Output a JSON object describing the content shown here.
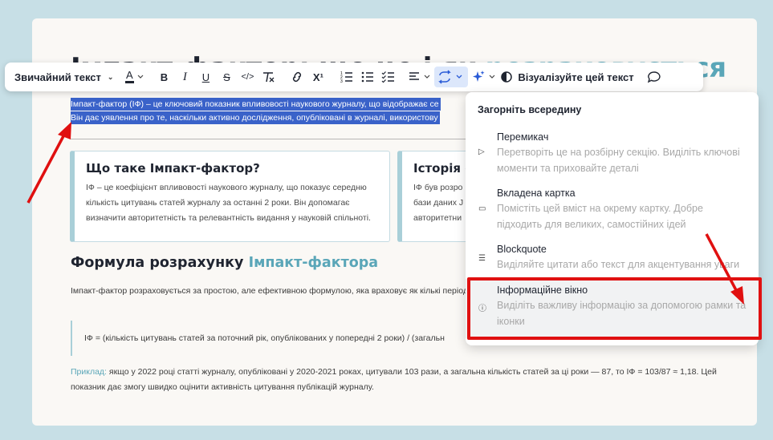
{
  "document": {
    "title_left": "Імпакт-фактор: що це і як",
    "title_right": "розраховується",
    "selected_line1": "Імпакт-фактор (ІФ) – це ключовий показник впливовості наукового журналу, що відображає се",
    "selected_line2": "Він дає уявлення про те, наскільки активно дослідження, опубліковані в журналі, використову",
    "card1_title": "Що таке Імпакт-фактор?",
    "card1_text": "ІФ – це коефіцієнт впливовості наукового журналу, що показує середню кількість цитувань статей журналу за останні 2 роки. Він допомагає визначити авторитетність та релевантність видання у науковій спільноті.",
    "card2_title": "Історія с",
    "card2_line1": "ІФ був розро",
    "card2_line2": "бази даних J",
    "card2_line3": "авторитетни",
    "heading2_a": "Формула розрахунку ",
    "heading2_b": "Імпакт-фактора",
    "paragraph": "Імпакт-фактор розраховується за простою, але ефективною формулою, яка враховує як кількі період.",
    "formula": "ІФ = (кількість цитувань статей за поточний рік, опублікованих у попередні 2 роки) / (загальн",
    "example_label": "Приклад:",
    "example_text": " якщо у 2022 році статті журналу, опубліковані у 2020-2021 роках, цитували 103 рази, а загальна кількість статей за ці роки — 87, то ІФ = 103/87 ≈ 1,18. Цей показник дає змогу швидко оцінити активність цитування публікацій журналу."
  },
  "toolbar": {
    "text_style": "Звичайний текст",
    "bold": "B",
    "italic": "I",
    "underline": "U",
    "strike": "S",
    "code": "</>",
    "superscript": "X¹",
    "visualize_label": "Візуалізуйте цей текст"
  },
  "menu": {
    "heading": "Загорніть всередину",
    "items": [
      {
        "title": "Перемикач",
        "desc": "Перетворіть це на розбірну секцію. Виділіть ключові моменти та приховайте деталі",
        "icon": "triangle-right-icon"
      },
      {
        "title": "Вкладена картка",
        "desc": "Помістіть цей вміст на окрему картку. Добре підходить для великих, самостійних ідей",
        "icon": "card-icon"
      },
      {
        "title": "Blockquote",
        "desc": "Виділяйте цитати або текст для акцентування уваги",
        "icon": "quote-icon"
      },
      {
        "title": "Інформаційне вікно",
        "desc": "Виділіть важливу інформацію за допомогою рамки та іконки",
        "icon": "info-icon"
      }
    ]
  },
  "colors": {
    "accent": "#5aa6b8",
    "selection": "#3a62c9",
    "highlight_red": "#e01010"
  }
}
